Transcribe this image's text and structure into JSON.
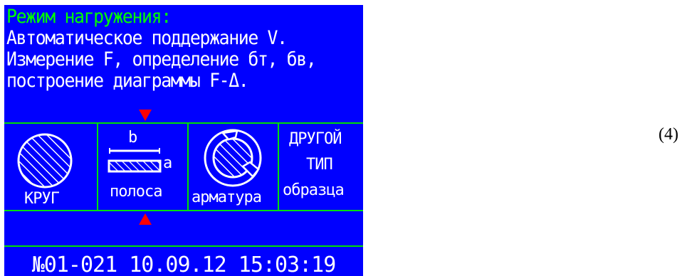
{
  "screen": {
    "title": "Режим нагружения:",
    "lines": [
      "Автоматическое поддержание V.",
      "Измерение F, определение бт, бв,",
      "построение диаграммы F-Δ."
    ]
  },
  "options": [
    {
      "label": "КРУГ",
      "icon": "circle-hatched-icon"
    },
    {
      "label": "полоса",
      "icon": "strip-hatched-icon",
      "dim_b": "b",
      "dim_a": "a"
    },
    {
      "label": "арматура",
      "icon": "rebar-hatched-icon"
    },
    {
      "label_line1": "ДРУГОЙ",
      "label_line2": "ТИП",
      "label_line3": "образца"
    }
  ],
  "footer": {
    "status": "№01-021 10.09.12 15:03:19"
  },
  "equation_number": "(4)",
  "colors": {
    "background": "#0000ff",
    "title": "#00ff00",
    "text": "#ffffff",
    "grid": "#00e000",
    "marker": "#ff0000"
  }
}
